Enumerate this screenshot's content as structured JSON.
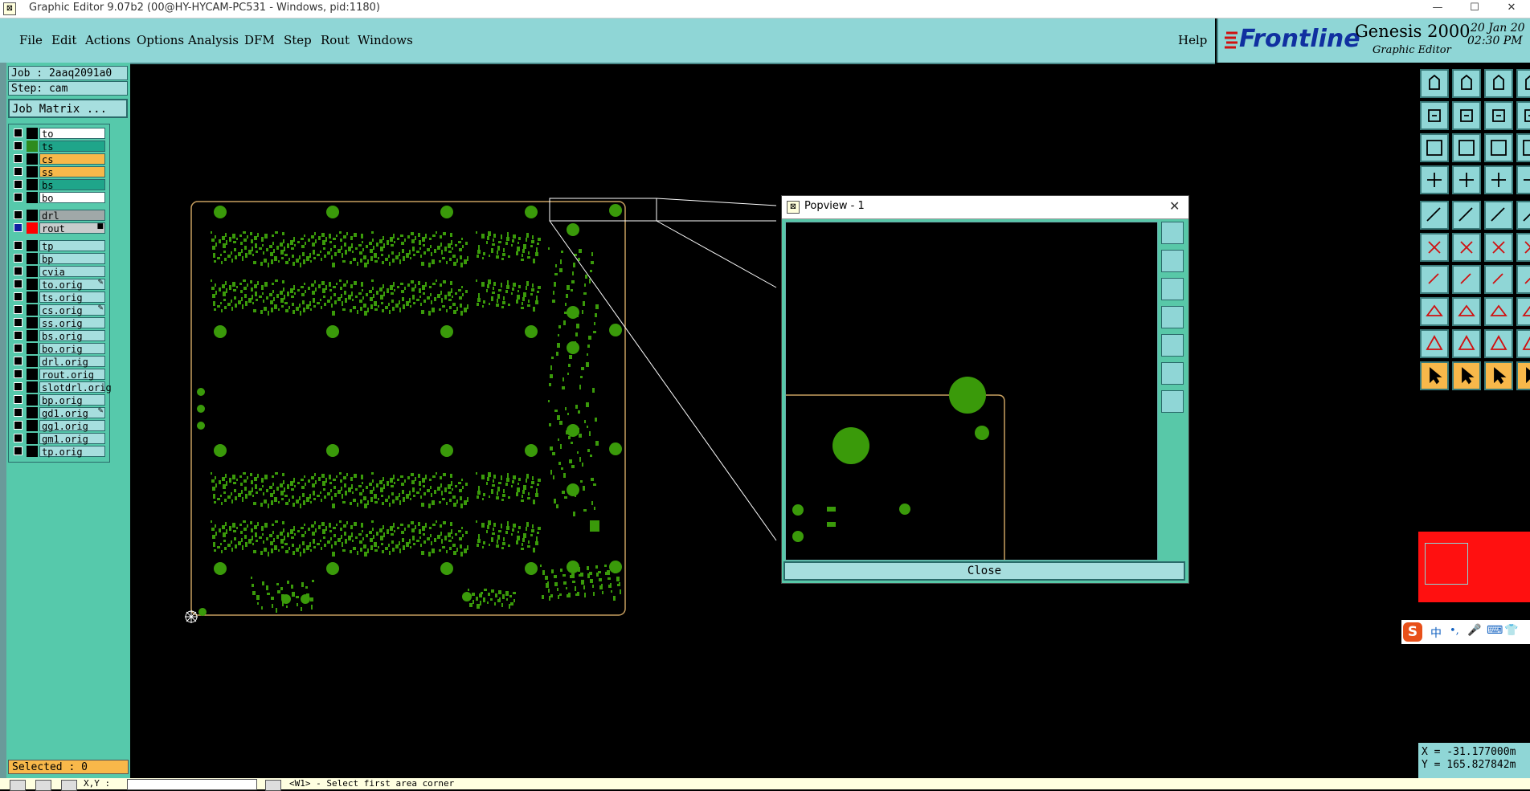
{
  "window": {
    "title": "Graphic Editor 9.07b2 (00@HY-HYCAM-PC531 - Windows, pid:1180)",
    "minimize": "—",
    "maximize": "☐",
    "close": "✕"
  },
  "menu": {
    "items": [
      "File",
      "Edit",
      "Actions",
      "Options",
      "Analysis",
      "DFM",
      "Step",
      "Rout",
      "Windows"
    ],
    "help": "Help"
  },
  "logo": {
    "brand": "Frontline",
    "product": "Genesis 2000",
    "subtitle": "Graphic Editor",
    "date": "20 Jan 20",
    "time": "02:30 PM"
  },
  "info": {
    "job": "Job : 2aaq2091a0",
    "step": "Step: cam",
    "job_matrix": "Job Matrix ..."
  },
  "layers": [
    {
      "name": "to",
      "bg": "#ffffff",
      "swatch": "#000000",
      "mark": ""
    },
    {
      "name": "ts",
      "bg": "#1fa58a",
      "swatch": "#2e8b1e",
      "mark": ""
    },
    {
      "name": "cs",
      "bg": "#f8b84a",
      "swatch": "#000000",
      "mark": ""
    },
    {
      "name": "ss",
      "bg": "#f8b84a",
      "swatch": "#000000",
      "mark": ""
    },
    {
      "name": "bs",
      "bg": "#1fa58a",
      "swatch": "#000000",
      "mark": ""
    },
    {
      "name": "bo",
      "bg": "#ffffff",
      "swatch": "#000000",
      "mark": ""
    },
    {
      "name": "drl",
      "bg": "#a0a8a8",
      "swatch": "#000000",
      "mark": ""
    },
    {
      "name": "rout",
      "bg": "#c8cccc",
      "swatch": "#ff0000",
      "mark": "■"
    },
    {
      "name": "tp",
      "bg": "#a6dede",
      "swatch": "#000000",
      "mark": ""
    },
    {
      "name": "bp",
      "bg": "#a6dede",
      "swatch": "#000000",
      "mark": ""
    },
    {
      "name": "cvia",
      "bg": "#a6dede",
      "swatch": "#000000",
      "mark": ""
    },
    {
      "name": "to.orig",
      "bg": "#a6dede",
      "swatch": "#000000",
      "mark": "✎"
    },
    {
      "name": "ts.orig",
      "bg": "#a6dede",
      "swatch": "#000000",
      "mark": ""
    },
    {
      "name": "cs.orig",
      "bg": "#a6dede",
      "swatch": "#000000",
      "mark": "✎"
    },
    {
      "name": "ss.orig",
      "bg": "#a6dede",
      "swatch": "#000000",
      "mark": ""
    },
    {
      "name": "bs.orig",
      "bg": "#a6dede",
      "swatch": "#000000",
      "mark": ""
    },
    {
      "name": "bo.orig",
      "bg": "#a6dede",
      "swatch": "#000000",
      "mark": ""
    },
    {
      "name": "drl.orig",
      "bg": "#a6dede",
      "swatch": "#000000",
      "mark": ""
    },
    {
      "name": "rout.orig",
      "bg": "#a6dede",
      "swatch": "#000000",
      "mark": ""
    },
    {
      "name": "slotdrl.orig",
      "bg": "#a6dede",
      "swatch": "#000000",
      "mark": ""
    },
    {
      "name": "bp.orig",
      "bg": "#a6dede",
      "swatch": "#000000",
      "mark": ""
    },
    {
      "name": "gd1.orig",
      "bg": "#a6dede",
      "swatch": "#000000",
      "mark": "✎"
    },
    {
      "name": "gg1.orig",
      "bg": "#a6dede",
      "swatch": "#000000",
      "mark": ""
    },
    {
      "name": "gm1.orig",
      "bg": "#a6dede",
      "swatch": "#000000",
      "mark": ""
    },
    {
      "name": "tp.orig",
      "bg": "#a6dede",
      "swatch": "#000000",
      "mark": ""
    }
  ],
  "selected": "Selected : 0",
  "popview": {
    "title": "Popview - 1",
    "close_label": "Close"
  },
  "coords": {
    "x": "X = -31.177000m",
    "y": "Y = 165.827842m"
  },
  "status": {
    "prompt": "<W1> - Select first area corner",
    "xy_label": "X,Y :"
  },
  "colors": {
    "pad_green": "#3a9a0a",
    "outline": "#c8a060",
    "panel_teal": "#56c9ab",
    "menu_bg": "#8fd6d6"
  }
}
